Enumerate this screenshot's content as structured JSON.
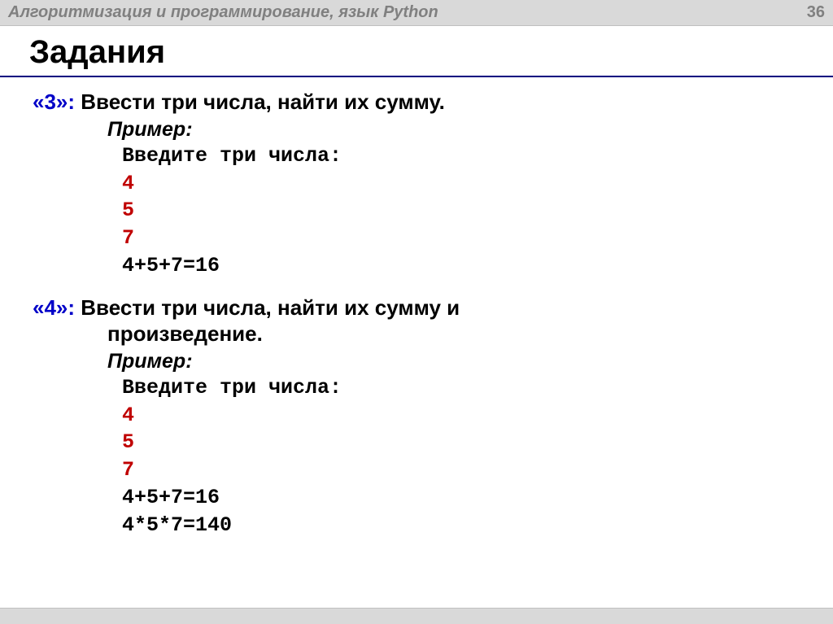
{
  "header": {
    "title": "Алгоритмизация и программирование, язык Python",
    "page": "36"
  },
  "title": "Задания",
  "tasks": [
    {
      "grade": "«3»:",
      "text": "Ввести три числа, найти их сумму.",
      "cont": "",
      "example_label": "Пример:",
      "prompt": "Введите три числа:",
      "inputs": [
        "4",
        "5",
        "7"
      ],
      "outputs": [
        "4+5+7=16"
      ]
    },
    {
      "grade": "«4»:",
      "text": "Ввести три числа, найти их сумму и",
      "cont": "произведение.",
      "example_label": "Пример:",
      "prompt": "Введите три числа:",
      "inputs": [
        "4",
        "5",
        "7"
      ],
      "outputs": [
        "4+5+7=16",
        "4*5*7=140"
      ]
    }
  ]
}
